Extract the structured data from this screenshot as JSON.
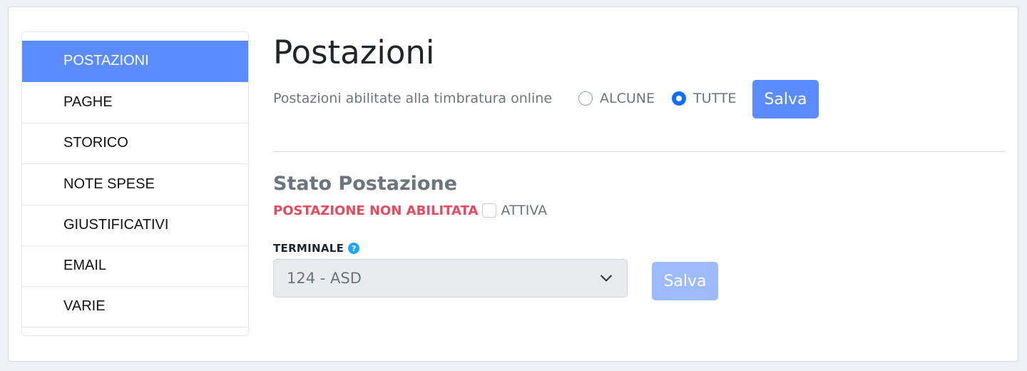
{
  "sidebar": {
    "items": [
      {
        "label": "POSTAZIONI",
        "active": true
      },
      {
        "label": "PAGHE"
      },
      {
        "label": "STORICO"
      },
      {
        "label": "NOTE SPESE"
      },
      {
        "label": "GIUSTIFICATIVI"
      },
      {
        "label": "EMAIL"
      },
      {
        "label": "VARIE"
      }
    ]
  },
  "main": {
    "title": "Postazioni",
    "online_setting": {
      "label": "Postazioni abilitate alla timbratura online",
      "options": [
        {
          "label": "ALCUNE",
          "checked": false
        },
        {
          "label": "TUTTE",
          "checked": true
        }
      ],
      "save_label": "Salva"
    },
    "status_section": {
      "title": "Stato Postazione",
      "status_text": "POSTAZIONE NON ABILITATA",
      "checkbox_label": "ATTIVA",
      "checkbox_checked": false
    },
    "terminal": {
      "label": "TERMINALE",
      "help_glyph": "?",
      "selected_value": "124 - ASD",
      "save_label": "Salva"
    }
  },
  "colors": {
    "accent": "#5b8cff",
    "accent_disabled": "#9fbbff",
    "radio_checked": "#0d6efd",
    "status_red": "#e8495c",
    "help_icon": "#1ea7fd"
  }
}
